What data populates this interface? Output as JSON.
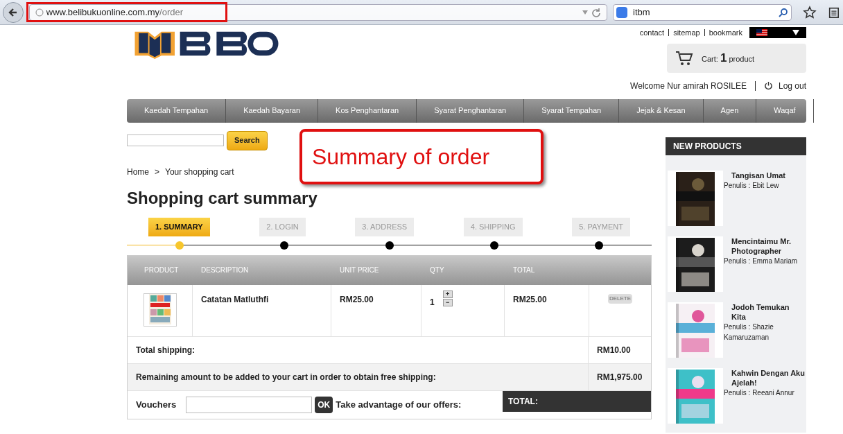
{
  "browser": {
    "url_host": "www.belibukuonline.com.my",
    "url_path": "/order",
    "search_value": "itbm"
  },
  "header": {
    "links": [
      "contact",
      "sitemap",
      "bookmark"
    ],
    "cart_label": "Cart:",
    "cart_count": "1",
    "cart_unit": "product",
    "welcome": "Welcome Nur amirah ROSILEE",
    "logout": "Log out"
  },
  "nav": [
    "Kaedah Tempahan",
    "Kaedah Bayaran",
    "Kos Penghantaran",
    "Syarat Penghantaran",
    "Syarat Tempahan",
    "Jejak & Kesan",
    "Agen",
    "Waqaf"
  ],
  "search": {
    "button": "Search"
  },
  "annotation": "Summary of order",
  "breadcrumb": [
    "Home",
    ">",
    "Your shopping cart"
  ],
  "title": "Shopping cart summary",
  "steps": [
    {
      "label": "1. SUMMARY",
      "selected": true
    },
    {
      "label": "2. LOGIN",
      "selected": false
    },
    {
      "label": "3. ADDRESS",
      "selected": false
    },
    {
      "label": "4. SHIPPING",
      "selected": false
    },
    {
      "label": "5. PAYMENT",
      "selected": false
    }
  ],
  "cart_table": {
    "columns": [
      "PRODUCT",
      "DESCRIPTION",
      "UNIT PRICE",
      "QTY",
      "TOTAL"
    ],
    "rows": [
      {
        "description": "Catatan Matluthfi",
        "unit_price": "RM25.00",
        "qty": "1",
        "plus": "+",
        "minus": "−",
        "total": "RM25.00",
        "delete": "DELETE"
      }
    ],
    "shipping_label": "Total shipping:",
    "shipping_value": "RM10.00",
    "remaining_label": "Remaining amount to be added to your cart in order to obtain free shipping:",
    "remaining_value": "RM1,975.00",
    "vouchers_label": "Vouchers",
    "ok": "OK",
    "offers": "Take advantage of our offers:",
    "total_label": "TOTAL:"
  },
  "sidebar": {
    "title": "NEW PRODUCTS",
    "items": [
      {
        "title": "Tangisan Umat",
        "author": "Penulis : Ebit Lew"
      },
      {
        "title": "Mencintaimu Mr. Photographer",
        "author": "Penulis : Emma Mariam"
      },
      {
        "title": "Jodoh Temukan Kita",
        "author": "Penulis : Shazie Kamaruzaman"
      },
      {
        "title": "Kahwin Dengan Aku Ajelah!",
        "author": "Penulis : Reeani Annur"
      }
    ]
  }
}
